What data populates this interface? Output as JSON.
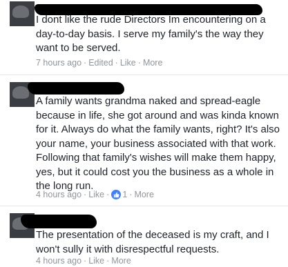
{
  "comments": [
    {
      "text": "I dont like the rude Directors Im encountering on a day-to-day basis. I serve my family's the way they want to be served.",
      "time": "7 hours ago",
      "edited": "Edited",
      "like": "Like",
      "more": "More",
      "reaction_count": ""
    },
    {
      "text": "A family wants grandma naked and spread-eagle because in life, she got around and was kinda known for it. Always do what the family wants, right? It's also your name, your business associated with that work. Following that family's wishes will make them happy, yes, but it could cost you the business as a whole in the long run.",
      "time": "4 hours ago",
      "edited": "",
      "like": "Like",
      "more": "More",
      "reaction_count": "1"
    },
    {
      "text": "The presentation of the deceased is my craft, and I won't sully it with disrespectful requests.",
      "time": "4 hours ago",
      "edited": "",
      "like": "Like",
      "more": "More",
      "reaction_count": ""
    }
  ],
  "separator": "·",
  "icons": {
    "reaction": "like-thumb-icon",
    "reaction_color": "#4080ff"
  }
}
